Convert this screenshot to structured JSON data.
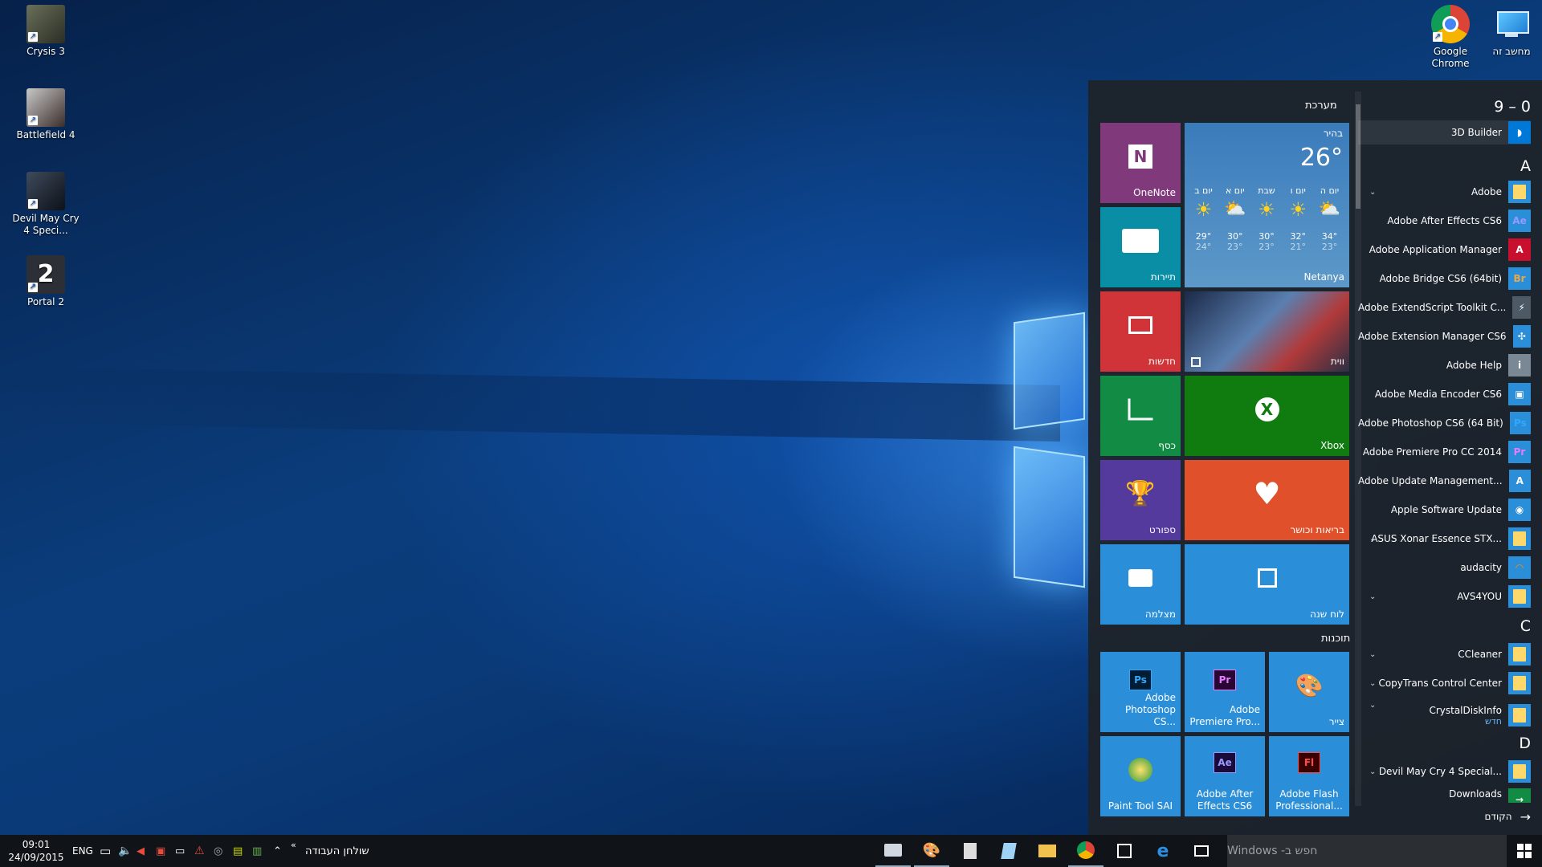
{
  "desktop": {
    "left_icons": [
      {
        "label": "Crysis 3"
      },
      {
        "label": "Battlefield 4"
      },
      {
        "label": "Devil May Cry 4 Speci..."
      },
      {
        "label": "Portal 2"
      }
    ],
    "right_icons": [
      {
        "label": "Google Chrome"
      },
      {
        "label": "מחשב זה"
      }
    ]
  },
  "start_menu": {
    "group_system": "מערכת",
    "group_programs": "תוכנות",
    "tiles": {
      "onenote": "OneNote",
      "travel": "תיירות",
      "news": "חדשות",
      "money": "כסף",
      "sport": "ספורט",
      "camera": "מצלמה",
      "games": "ווית",
      "xbox": "Xbox",
      "health": "בריאות וכושר",
      "calendar": "לוח שנה",
      "photoshop": "Adobe Photoshop CS...",
      "premiere": "Adobe Premiere Pro...",
      "paint": "צייר",
      "sai": "Paint Tool SAI",
      "aftereffects": "Adobe After Effects CS6",
      "flash": "Adobe Flash Professional..."
    },
    "weather": {
      "condition": "בהיר",
      "temp": "26°",
      "city": "Netanya",
      "days": [
        {
          "day": "יום ב",
          "hi": "29°",
          "lo": "24°"
        },
        {
          "day": "יום א",
          "hi": "30°",
          "lo": "23°"
        },
        {
          "day": "שבת",
          "hi": "30°",
          "lo": "23°"
        },
        {
          "day": "יום ו",
          "hi": "32°",
          "lo": "21°"
        },
        {
          "day": "יום ה",
          "hi": "34°",
          "lo": "23°"
        }
      ]
    },
    "app_list": {
      "header": "9 – 0",
      "letter_a": "A",
      "letter_c": "C",
      "letter_d": "D",
      "items": [
        {
          "name": "3D Builder"
        },
        {
          "name": "Adobe"
        },
        {
          "name": "Adobe After Effects CS6",
          "icon": "Ae"
        },
        {
          "name": "Adobe Application Manager",
          "icon": "A"
        },
        {
          "name": "Adobe Bridge CS6 (64bit)",
          "icon": "Br"
        },
        {
          "name": "Adobe ExtendScript Toolkit C..."
        },
        {
          "name": "Adobe Extension Manager CS6"
        },
        {
          "name": "Adobe Help",
          "icon": "i"
        },
        {
          "name": "Adobe Media Encoder CS6"
        },
        {
          "name": "Adobe Photoshop CS6 (64 Bit)",
          "icon": "Ps"
        },
        {
          "name": "Adobe Premiere Pro CC 2014",
          "icon": "Pr"
        },
        {
          "name": "Adobe Update Management...",
          "icon": "A"
        },
        {
          "name": "Apple Software Update"
        },
        {
          "name": "ASUS Xonar Essence STX..."
        },
        {
          "name": "audacity"
        },
        {
          "name": "AVS4YOU"
        },
        {
          "name": "CCleaner"
        },
        {
          "name": "CopyTrans Control Center"
        },
        {
          "name": "CrystalDiskInfo",
          "badge": "חדש"
        },
        {
          "name": "Devil May Cry 4 Special..."
        },
        {
          "name": "Downloads"
        }
      ],
      "back": "הקודם"
    }
  },
  "taskbar": {
    "search_placeholder": "חפש ב- Windows",
    "desktop_label": "שולחן העבודה",
    "lang": "ENG",
    "time": "09:01",
    "date": "24/09/2015"
  }
}
